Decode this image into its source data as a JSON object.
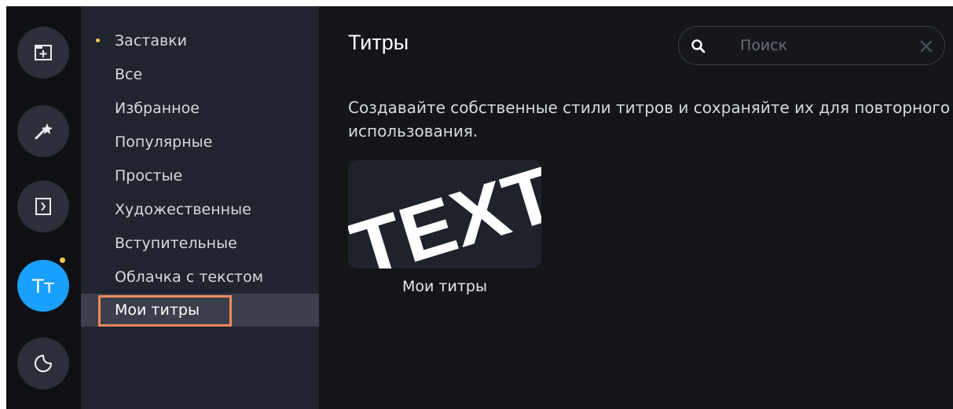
{
  "rail": {
    "items": [
      {
        "name": "import-files",
        "icon": "folder-plus-icon"
      },
      {
        "name": "filters",
        "icon": "magic-wand-icon"
      },
      {
        "name": "transitions",
        "icon": "transition-icon"
      },
      {
        "name": "titles",
        "icon": "titles-tt-icon",
        "active": true,
        "glyph": "Tт"
      },
      {
        "name": "stickers",
        "icon": "sticker-icon"
      }
    ]
  },
  "sidebar": {
    "items": [
      {
        "label": "Заставки",
        "dot": true
      },
      {
        "label": "Все"
      },
      {
        "label": "Избранное"
      },
      {
        "label": "Популярные"
      },
      {
        "label": "Простые"
      },
      {
        "label": "Художественные"
      },
      {
        "label": "Вступительные"
      },
      {
        "label": "Облачка с текстом"
      },
      {
        "label": "Мои титры",
        "selected": true
      }
    ]
  },
  "main": {
    "title": "Титры",
    "search_placeholder": "Поиск",
    "description": "Создавайте собственные стили титров и сохраняйте их для повторного использования.",
    "card": {
      "thumbnail_text": "TEXT",
      "label": "Мои титры"
    }
  },
  "colors": {
    "accent": "#1aa0ff",
    "highlight": "#f08a5d",
    "dot": "#f2c94c"
  }
}
